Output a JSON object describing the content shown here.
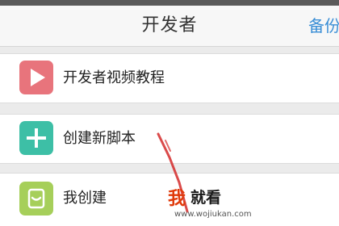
{
  "navbar": {
    "title": "开发者",
    "action_label": "备份"
  },
  "menu": [
    {
      "label": "开发者视频教程",
      "icon": "play-icon",
      "icon_color": "#e8747c"
    },
    {
      "label": "创建新脚本",
      "icon": "plus-icon",
      "icon_color": "#3dbfa6"
    },
    {
      "label": "我创建",
      "icon": "document-icon",
      "icon_color": "#a6cf5a"
    }
  ],
  "watermark": {
    "brand_part1": "我",
    "brand_part2": "就看",
    "url": "www.wojiukan.com"
  },
  "colors": {
    "accent_blue": "#3b8fd6",
    "annotation_red": "#d42a2a",
    "watermark_red": "#e03a0a"
  }
}
